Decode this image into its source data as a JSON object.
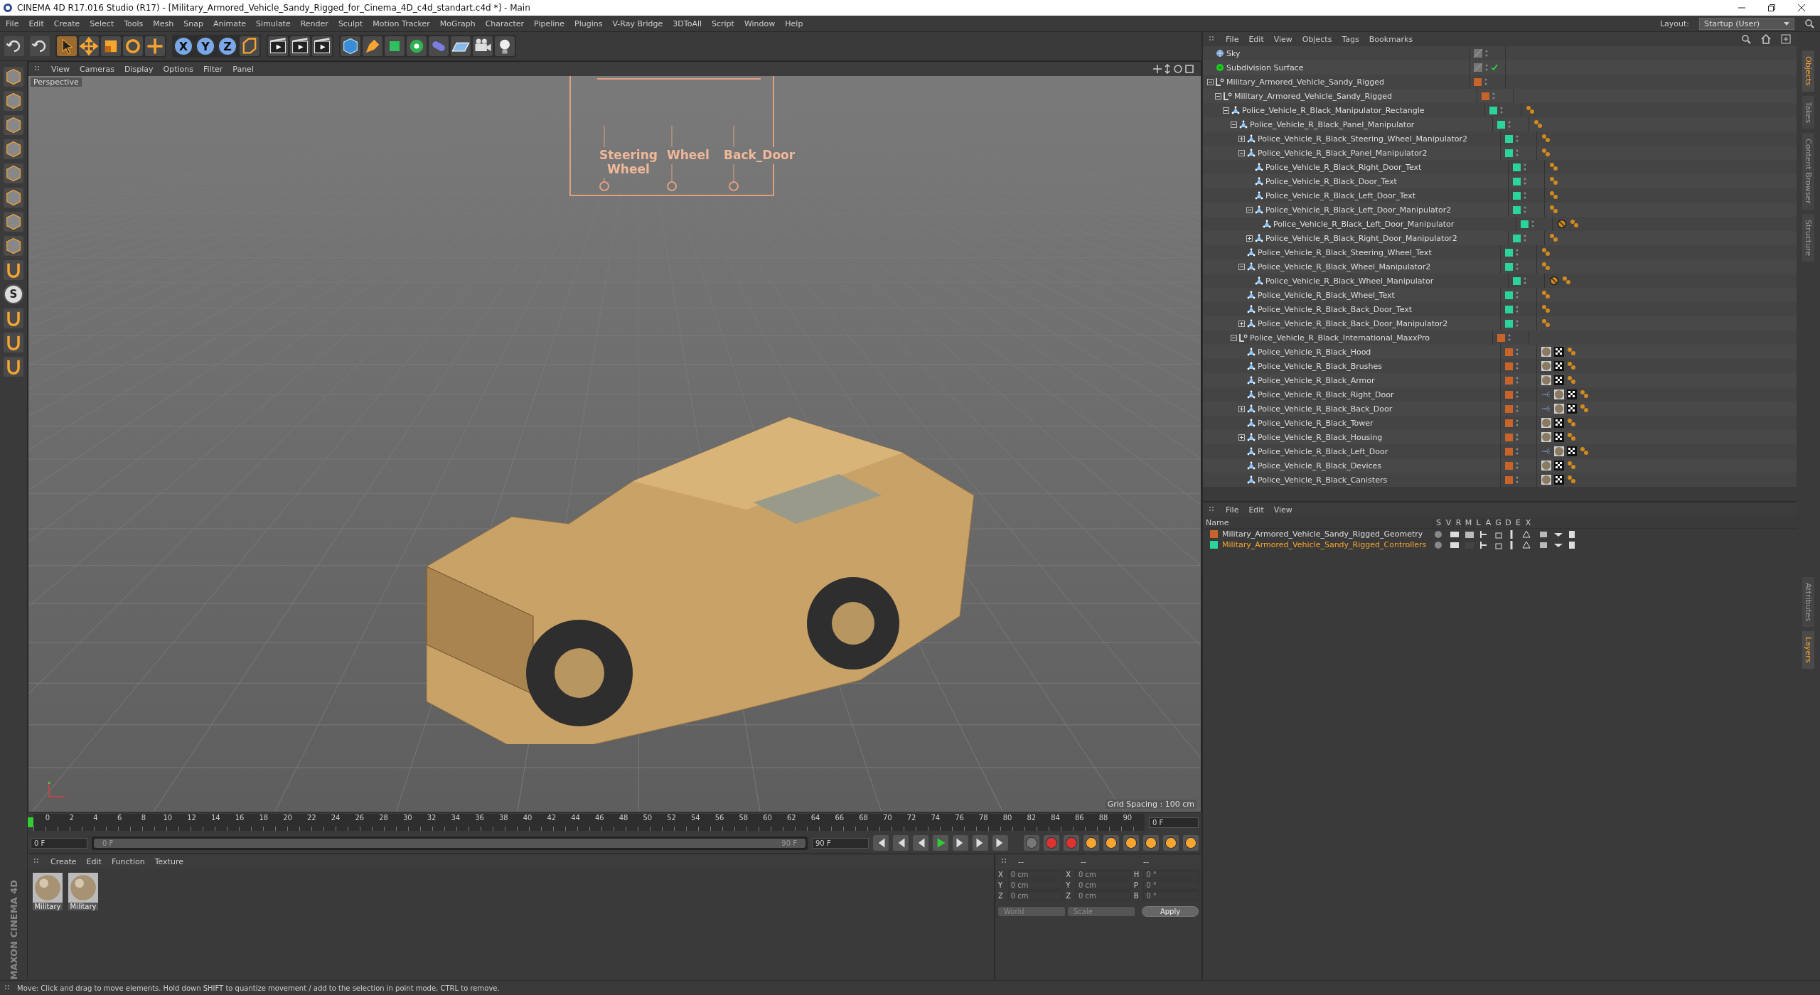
{
  "window": {
    "title": "CINEMA 4D R17.016 Studio (R17) - [Military_Armored_Vehicle_Sandy_Rigged_for_Cinema_4D_c4d_standart.c4d *] - Main"
  },
  "menu": [
    "File",
    "Edit",
    "Create",
    "Select",
    "Tools",
    "Mesh",
    "Snap",
    "Animate",
    "Simulate",
    "Render",
    "Sculpt",
    "Motion Tracker",
    "MoGraph",
    "Character",
    "Pipeline",
    "Plugins",
    "V-Ray Bridge",
    "3DToAll",
    "Script",
    "Window",
    "Help"
  ],
  "layout": {
    "label": "Layout:",
    "value": "Startup (User)"
  },
  "axis_buttons": [
    "X",
    "Y",
    "Z"
  ],
  "side_toolbar_letter": "S",
  "logo": "MAXON CINEMA 4D",
  "viewport": {
    "menu": [
      "View",
      "Cameras",
      "Display",
      "Options",
      "Filter",
      "Panel"
    ],
    "camera": "Perspective",
    "panel_labels": [
      "Steering Wheel",
      "Wheel",
      "Back_Door"
    ],
    "grid_spacing": "Grid Spacing : 100 cm"
  },
  "timeline": {
    "ticks": [
      "0",
      "2",
      "4",
      "6",
      "8",
      "10",
      "12",
      "14",
      "16",
      "18",
      "20",
      "22",
      "24",
      "26",
      "28",
      "30",
      "32",
      "34",
      "36",
      "38",
      "40",
      "42",
      "44",
      "46",
      "48",
      "50",
      "52",
      "54",
      "56",
      "58",
      "60",
      "62",
      "64",
      "66",
      "68",
      "70",
      "72",
      "74",
      "76",
      "78",
      "80",
      "82",
      "84",
      "86",
      "88",
      "90"
    ],
    "current_frame": "0 F",
    "start_field": "0 F",
    "range": {
      "start": "0 F",
      "end": "90 F",
      "level": 1
    },
    "end_field": "90 F"
  },
  "material_manager": {
    "menu": [
      "Create",
      "Edit",
      "Function",
      "Texture"
    ],
    "materials": [
      "Military",
      "Military"
    ]
  },
  "coordinates": {
    "headers": [
      "--",
      "--",
      "--"
    ],
    "rows": [
      {
        "cells": [
          {
            "label": "X",
            "value": "0 cm"
          },
          {
            "label": "X",
            "value": "0 cm"
          },
          {
            "label": "H",
            "value": "0 °"
          }
        ]
      },
      {
        "cells": [
          {
            "label": "Y",
            "value": "0 cm"
          },
          {
            "label": "Y",
            "value": "0 cm"
          },
          {
            "label": "P",
            "value": "0 °"
          }
        ]
      },
      {
        "cells": [
          {
            "label": "Z",
            "value": "0 cm"
          },
          {
            "label": "Z",
            "value": "0 cm"
          },
          {
            "label": "B",
            "value": "0 °"
          }
        ]
      }
    ],
    "dropdowns": [
      "World",
      "Scale"
    ],
    "apply": "Apply"
  },
  "status_bar": "Move: Click and drag to move elements. Hold down SHIFT to quantize movement / add to the selection in point mode, CTRL to remove.",
  "object_manager": {
    "menu": [
      "File",
      "Edit",
      "View",
      "Objects",
      "Tags",
      "Bookmarks"
    ],
    "tree": [
      {
        "name": "Sky",
        "kind": "sky"
      },
      {
        "name": "Subdivision Surface",
        "kind": "subdivision",
        "enabled": true
      },
      {
        "name": "Military_Armored_Vehicle_Sandy_Rigged",
        "kind": "null",
        "color": "#c8642a",
        "expanded": true,
        "children": [
          {
            "name": "Military_Armored_Vehicle_Sandy_Rigged",
            "kind": "null",
            "color": "#c8642a",
            "expanded": true,
            "children": [
              {
                "name": "Police_Vehicle_R_Black_Manipulator_Rectangle",
                "kind": "joint",
                "color": "#2ad49a",
                "expanded": true,
                "tags": [
                  {
                    "kind": "ik"
                  }
                ],
                "children": [
                  {
                    "name": "Police_Vehicle_R_Black_Panel_Manipulator",
                    "kind": "joint",
                    "color": "#2ad49a",
                    "expanded": true,
                    "tags": [
                      {
                        "kind": "ik"
                      }
                    ],
                    "children": [
                      {
                        "name": "Police_Vehicle_R_Black_Steering_Wheel_Manipulator2",
                        "kind": "joint",
                        "color": "#2ad49a",
                        "expanded": false,
                        "tags": [
                          {
                            "kind": "ik"
                          }
                        ]
                      },
                      {
                        "name": "Police_Vehicle_R_Black_Panel_Manipulator2",
                        "kind": "joint",
                        "color": "#2ad49a",
                        "expanded": true,
                        "tags": [
                          {
                            "kind": "ik"
                          }
                        ],
                        "children": [
                          {
                            "name": "Police_Vehicle_R_Black_Right_Door_Text",
                            "kind": "joint",
                            "color": "#2ad49a",
                            "tags": [
                              {
                                "kind": "ik"
                              }
                            ]
                          },
                          {
                            "name": "Police_Vehicle_R_Black_Door_Text",
                            "kind": "joint",
                            "color": "#2ad49a",
                            "tags": [
                              {
                                "kind": "ik"
                              }
                            ]
                          },
                          {
                            "name": "Police_Vehicle_R_Black_Left_Door_Text",
                            "kind": "joint",
                            "color": "#2ad49a",
                            "tags": [
                              {
                                "kind": "ik"
                              }
                            ]
                          },
                          {
                            "name": "Police_Vehicle_R_Black_Left_Door_Manipulator2",
                            "kind": "joint",
                            "color": "#2ad49a",
                            "expanded": true,
                            "tags": [
                              {
                                "kind": "ik"
                              }
                            ],
                            "children": [
                              {
                                "name": "Police_Vehicle_R_Black_Left_Door_Manipulator",
                                "kind": "joint",
                                "color": "#2ad49a",
                                "tags": [
                                  {
                                    "kind": "protection"
                                  },
                                  {
                                    "kind": "ik"
                                  }
                                ]
                              }
                            ]
                          },
                          {
                            "name": "Police_Vehicle_R_Black_Right_Door_Manipulator2",
                            "kind": "joint",
                            "color": "#2ad49a",
                            "expanded": false,
                            "tags": [
                              {
                                "kind": "ik"
                              }
                            ]
                          }
                        ]
                      },
                      {
                        "name": "Police_Vehicle_R_Black_Steering_Wheel_Text",
                        "kind": "joint",
                        "color": "#2ad49a",
                        "tags": [
                          {
                            "kind": "ik"
                          }
                        ]
                      },
                      {
                        "name": "Police_Vehicle_R_Black_Wheel_Manipulator2",
                        "kind": "joint",
                        "color": "#2ad49a",
                        "expanded": true,
                        "tags": [
                          {
                            "kind": "ik"
                          }
                        ],
                        "children": [
                          {
                            "name": "Police_Vehicle_R_Black_Wheel_Manipulator",
                            "kind": "joint",
                            "color": "#2ad49a",
                            "tags": [
                              {
                                "kind": "protection"
                              },
                              {
                                "kind": "ik"
                              }
                            ]
                          }
                        ]
                      },
                      {
                        "name": "Police_Vehicle_R_Black_Wheel_Text",
                        "kind": "joint",
                        "color": "#2ad49a",
                        "tags": [
                          {
                            "kind": "ik"
                          }
                        ]
                      },
                      {
                        "name": "Police_Vehicle_R_Black_Back_Door_Text",
                        "kind": "joint",
                        "color": "#2ad49a",
                        "tags": [
                          {
                            "kind": "ik"
                          }
                        ]
                      },
                      {
                        "name": "Police_Vehicle_R_Black_Back_Door_Manipulator2",
                        "kind": "joint",
                        "color": "#2ad49a",
                        "expanded": false,
                        "tags": [
                          {
                            "kind": "ik"
                          }
                        ]
                      }
                    ]
                  },
                  {
                    "name": "Police_Vehicle_R_Black_International_MaxxPro",
                    "kind": "null",
                    "color": "#c8642a",
                    "expanded": true,
                    "children": [
                      {
                        "name": "Police_Vehicle_R_Black_Hood",
                        "kind": "joint",
                        "color": "#c8642a",
                        "tags": [
                          {
                            "kind": "material"
                          },
                          {
                            "kind": "checker"
                          },
                          {
                            "kind": "ik"
                          }
                        ]
                      },
                      {
                        "name": "Police_Vehicle_R_Black_Brushes",
                        "kind": "joint",
                        "color": "#c8642a",
                        "tags": [
                          {
                            "kind": "material"
                          },
                          {
                            "kind": "checker"
                          },
                          {
                            "kind": "ik"
                          }
                        ]
                      },
                      {
                        "name": "Police_Vehicle_R_Black_Armor",
                        "kind": "joint",
                        "color": "#c8642a",
                        "tags": [
                          {
                            "kind": "material"
                          },
                          {
                            "kind": "checker"
                          },
                          {
                            "kind": "ik"
                          }
                        ]
                      },
                      {
                        "name": "Police_Vehicle_R_Black_Right_Door",
                        "kind": "joint",
                        "color": "#c8642a",
                        "tags": [
                          {
                            "kind": "hierarchy"
                          },
                          {
                            "kind": "material"
                          },
                          {
                            "kind": "checker"
                          },
                          {
                            "kind": "ik"
                          }
                        ]
                      },
                      {
                        "name": "Police_Vehicle_R_Black_Back_Door",
                        "kind": "joint",
                        "color": "#c8642a",
                        "expanded": false,
                        "tags": [
                          {
                            "kind": "hierarchy"
                          },
                          {
                            "kind": "material"
                          },
                          {
                            "kind": "checker"
                          },
                          {
                            "kind": "ik"
                          }
                        ]
                      },
                      {
                        "name": "Police_Vehicle_R_Black_Tower",
                        "kind": "joint",
                        "color": "#c8642a",
                        "tags": [
                          {
                            "kind": "material"
                          },
                          {
                            "kind": "checker"
                          },
                          {
                            "kind": "ik"
                          }
                        ]
                      },
                      {
                        "name": "Police_Vehicle_R_Black_Housing",
                        "kind": "joint",
                        "color": "#c8642a",
                        "expanded": false,
                        "tags": [
                          {
                            "kind": "material"
                          },
                          {
                            "kind": "checker"
                          },
                          {
                            "kind": "ik"
                          }
                        ]
                      },
                      {
                        "name": "Police_Vehicle_R_Black_Left_Door",
                        "kind": "joint",
                        "color": "#c8642a",
                        "tags": [
                          {
                            "kind": "hierarchy"
                          },
                          {
                            "kind": "material"
                          },
                          {
                            "kind": "checker"
                          },
                          {
                            "kind": "ik"
                          }
                        ]
                      },
                      {
                        "name": "Police_Vehicle_R_Black_Devices",
                        "kind": "joint",
                        "color": "#c8642a",
                        "tags": [
                          {
                            "kind": "material"
                          },
                          {
                            "kind": "checker"
                          },
                          {
                            "kind": "ik"
                          }
                        ]
                      },
                      {
                        "name": "Police_Vehicle_R_Black_Canisters",
                        "kind": "joint",
                        "color": "#c8642a",
                        "tags": [
                          {
                            "kind": "material"
                          },
                          {
                            "kind": "checker"
                          },
                          {
                            "kind": "ik"
                          }
                        ]
                      }
                    ]
                  }
                ]
              }
            ]
          }
        ]
      }
    ]
  },
  "layer_manager": {
    "menu": [
      "File",
      "Edit",
      "View"
    ],
    "columns": [
      "Name",
      "S",
      "V",
      "R",
      "M",
      "L",
      "A",
      "G",
      "D",
      "E",
      "X"
    ],
    "layers": [
      {
        "name": "Military_Armored_Vehicle_Sandy_Rigged_Geometry",
        "color": "#c8642a",
        "selected": false
      },
      {
        "name": "Military_Armored_Vehicle_Sandy_Rigged_Controllers",
        "color": "#2ad49a",
        "selected": true
      }
    ]
  },
  "side_tabs": [
    {
      "label": "Objects",
      "selected": true
    },
    {
      "label": "Takes",
      "selected": false
    },
    {
      "label": "Content Browser",
      "selected": false
    },
    {
      "label": "Structure",
      "selected": false
    }
  ],
  "lower_side_tabs": [
    {
      "label": "Attributes",
      "selected": false
    },
    {
      "label": "Layers",
      "selected": true
    }
  ]
}
